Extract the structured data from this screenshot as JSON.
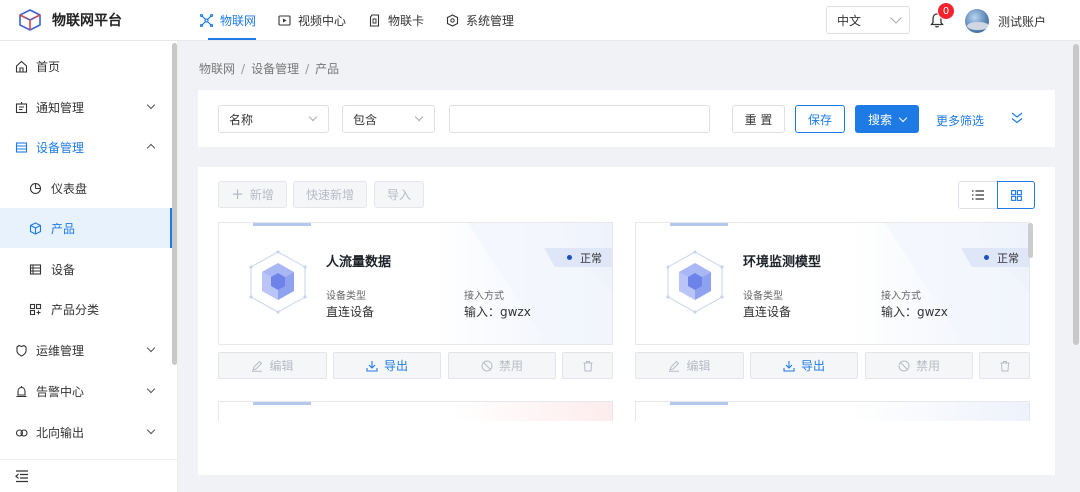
{
  "app": {
    "title": "物联网平台"
  },
  "topnav": [
    {
      "label": "物联网",
      "icon": "iot-grid-icon",
      "active": true
    },
    {
      "label": "视频中心",
      "icon": "video-icon",
      "active": false
    },
    {
      "label": "物联卡",
      "icon": "sim-card-icon",
      "active": false
    },
    {
      "label": "系统管理",
      "icon": "settings-cube-icon",
      "active": false
    }
  ],
  "header": {
    "language": "中文",
    "notification_count": "0",
    "user_name": "测试账户"
  },
  "sidebar": {
    "items": [
      {
        "label": "首页",
        "icon": "home-icon"
      },
      {
        "label": "通知管理",
        "icon": "notice-icon"
      },
      {
        "label": "设备管理",
        "icon": "device-manage-icon"
      },
      {
        "label": "仪表盘",
        "icon": "dashboard-icon"
      },
      {
        "label": "产品",
        "icon": "product-cube-icon"
      },
      {
        "label": "设备",
        "icon": "device-icon"
      },
      {
        "label": "产品分类",
        "icon": "category-icon"
      },
      {
        "label": "运维管理",
        "icon": "ops-icon"
      },
      {
        "label": "告警中心",
        "icon": "alarm-icon"
      },
      {
        "label": "北向输出",
        "icon": "output-icon"
      }
    ]
  },
  "breadcrumb": [
    "物联网",
    "设备管理",
    "产品"
  ],
  "filter": {
    "field": "名称",
    "operator": "包含",
    "value": "",
    "reset_label": "重 置",
    "save_label": "保存",
    "search_label": "搜索",
    "more_label": "更多筛选"
  },
  "toolbar": {
    "add_label": "新增",
    "quick_add_label": "快速新增",
    "import_label": "导入"
  },
  "cards": [
    {
      "title": "人流量数据",
      "status": "正常",
      "type_label": "设备类型",
      "type_value": "直连设备",
      "access_label": "接入方式",
      "access_value": "输入：gwzx",
      "edit_label": "编辑",
      "export_label": "导出",
      "disable_label": "禁用"
    },
    {
      "title": "环境监测模型",
      "status": "正常",
      "type_label": "设备类型",
      "type_value": "直连设备",
      "access_label": "接入方式",
      "access_value": "输入：gwzx",
      "edit_label": "编辑",
      "export_label": "导出",
      "disable_label": "禁用"
    }
  ],
  "colors": {
    "primary": "#1e7be6",
    "badge": "#f5222d",
    "status_dot": "#1e4fc0",
    "tag_bg": "#dfe6f7"
  }
}
